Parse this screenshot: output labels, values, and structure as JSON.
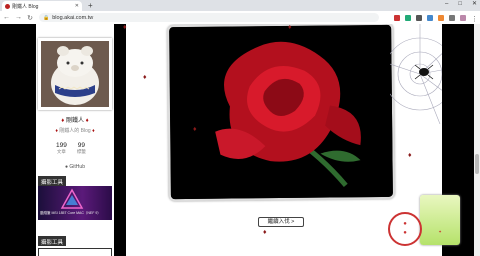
{
  "browser": {
    "tab_title": "剛鐵人 Blog",
    "url": "blog.akai.com.tw",
    "new_tab": "+",
    "window_controls": [
      "‒",
      "□",
      "✕"
    ]
  },
  "sidebar": {
    "author_name": "剛鐵人",
    "author_subtitle": "剛鐵人的 Blog",
    "stats": [
      {
        "value": "199",
        "label": "文章"
      },
      {
        "value": "99",
        "label": "標籤"
      }
    ],
    "github_label": "GitHub",
    "section1_title": "攝影工具",
    "promo_text": "腦殘筆 MSI 185T Core MAC（NEF 9）",
    "section2_title": "攝影工具"
  },
  "main": {
    "read_more_label": "繼續入伐 >"
  },
  "colors": {
    "page_black": "#000000",
    "accent_red": "#c0152a"
  }
}
